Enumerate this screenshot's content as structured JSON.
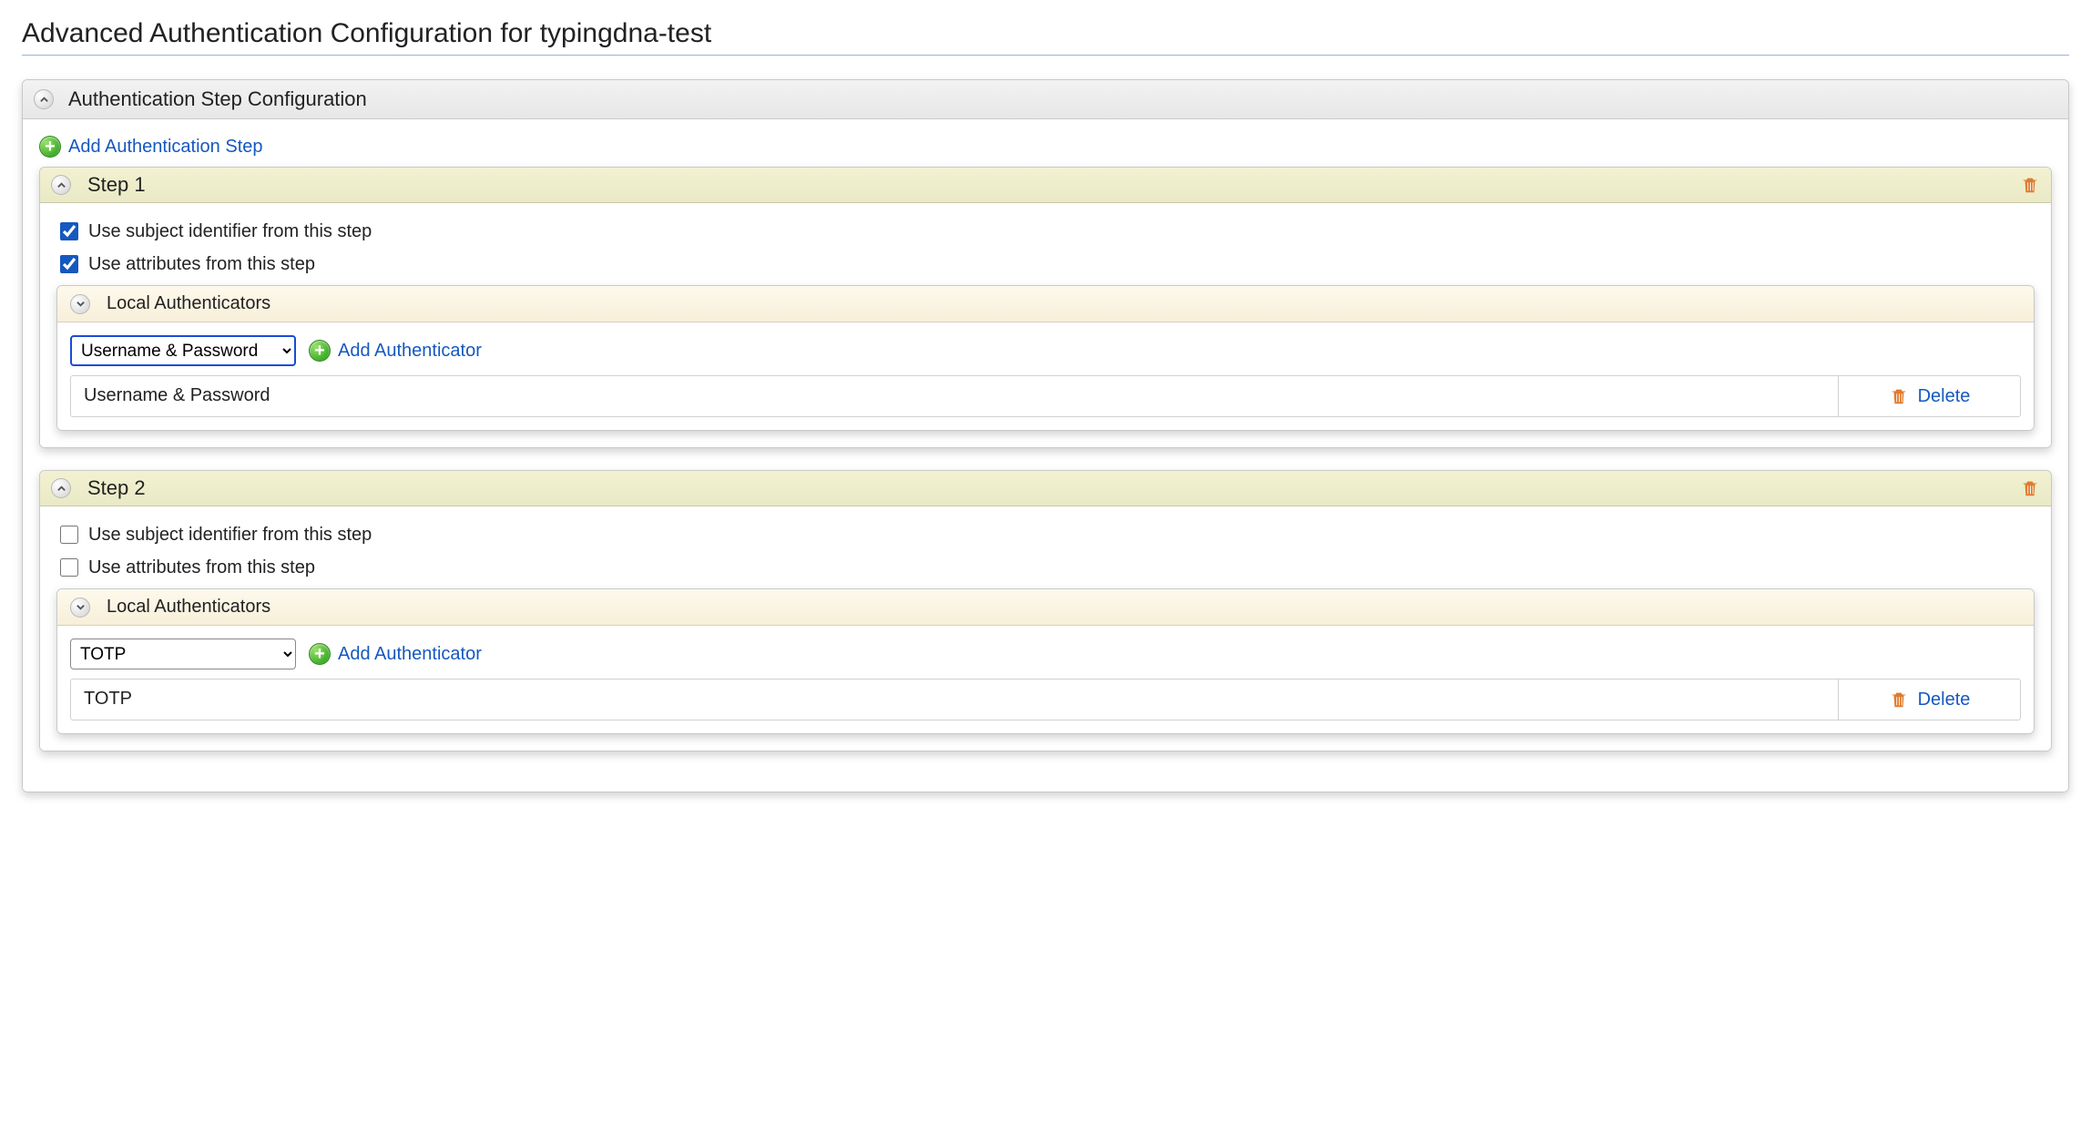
{
  "page": {
    "title": "Advanced Authentication Configuration for typingdna-test"
  },
  "panel": {
    "title": "Authentication Step Configuration",
    "add_step_label": "Add Authentication Step"
  },
  "steps": [
    {
      "title": "Step 1",
      "use_subject_label": "Use subject identifier from this step",
      "use_subject_checked": true,
      "use_attrs_label": "Use attributes from this step",
      "use_attrs_checked": true,
      "local_auth_title": "Local Authenticators",
      "selected_auth": "Username & Password",
      "select_highlight": true,
      "add_auth_label": "Add Authenticator",
      "auth_rows": [
        {
          "name": "Username & Password",
          "delete_label": "Delete"
        }
      ]
    },
    {
      "title": "Step 2",
      "use_subject_label": "Use subject identifier from this step",
      "use_subject_checked": false,
      "use_attrs_label": "Use attributes from this step",
      "use_attrs_checked": false,
      "local_auth_title": "Local Authenticators",
      "selected_auth": "TOTP",
      "select_highlight": false,
      "add_auth_label": "Add Authenticator",
      "auth_rows": [
        {
          "name": "TOTP",
          "delete_label": "Delete"
        }
      ]
    }
  ]
}
